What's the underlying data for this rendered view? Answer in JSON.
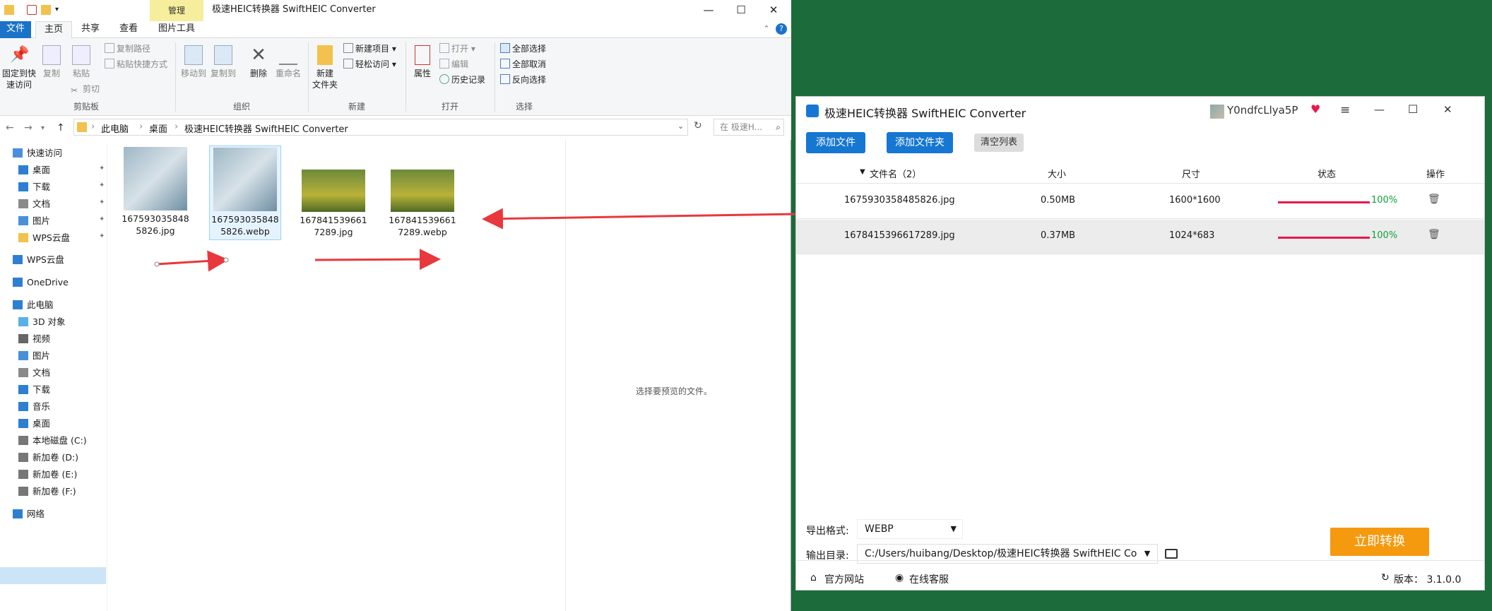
{
  "explorer": {
    "window_title": "极速HEIC转换器 SwiftHEIC Converter",
    "manage_tab": "管理",
    "tabs": [
      "文件",
      "主页",
      "共享",
      "查看",
      "图片工具"
    ],
    "ribbon": {
      "clipboard": {
        "pin": "固定到快速访问",
        "copy": "复制",
        "paste": "粘贴",
        "copy_path": "复制路径",
        "paste_shortcut": "粘贴快捷方式",
        "cut": "剪切",
        "label": "剪贴板"
      },
      "organize": {
        "move_to": "移动到",
        "copy_to": "复制到",
        "delete": "删除",
        "rename": "重命名",
        "label": "组织"
      },
      "new": {
        "new_item": "新建项目",
        "easy_access": "轻松访问",
        "new_folder": "新建\n文件夹",
        "label": "新建"
      },
      "open": {
        "properties": "属性",
        "open": "打开",
        "edit": "编辑",
        "history": "历史记录",
        "label": "打开"
      },
      "select": {
        "select_all": "全部选择",
        "select_none": "全部取消",
        "invert": "反向选择",
        "label": "选择"
      }
    },
    "breadcrumb": [
      "此电脑",
      "桌面",
      "极速HEIC转换器 SwiftHEIC Converter"
    ],
    "search_placeholder": "在 极速H...",
    "nav": [
      {
        "label": "快速访问"
      },
      {
        "label": "桌面"
      },
      {
        "label": "下载"
      },
      {
        "label": "文档"
      },
      {
        "label": "图片"
      },
      {
        "label": "WPS云盘"
      },
      {
        "label": "WPS云盘"
      },
      {
        "label": "OneDrive"
      },
      {
        "label": "此电脑"
      },
      {
        "label": "3D 对象"
      },
      {
        "label": "视频"
      },
      {
        "label": "图片"
      },
      {
        "label": "文档"
      },
      {
        "label": "下载"
      },
      {
        "label": "音乐"
      },
      {
        "label": "桌面"
      },
      {
        "label": "本地磁盘 (C:)"
      },
      {
        "label": "新加卷 (D:)"
      },
      {
        "label": "新加卷 (E:)"
      },
      {
        "label": "新加卷 (F:)"
      },
      {
        "label": "网络"
      }
    ],
    "files": [
      {
        "name": "1675930358485826.jpg"
      },
      {
        "name": "1675930358485826.webp"
      },
      {
        "name": "1678415396617289.jpg"
      },
      {
        "name": "1678415396617289.webp"
      }
    ],
    "preview_text": "选择要预览的文件。"
  },
  "converter": {
    "title": "极速HEIC转换器 SwiftHEIC Converter",
    "user": "Y0ndfcLlya5P",
    "buttons": {
      "add_file": "添加文件",
      "add_folder": "添加文件夹",
      "clear": "清空列表"
    },
    "columns": {
      "name": "文件名（2）",
      "size": "大小",
      "dimensions": "尺寸",
      "status": "状态",
      "actions": "操作"
    },
    "rows": [
      {
        "name": "1675930358485826.jpg",
        "size": "0.50MB",
        "dimensions": "1600*1600",
        "progress": "100%"
      },
      {
        "name": "1678415396617289.jpg",
        "size": "0.37MB",
        "dimensions": "1024*683",
        "progress": "100%"
      }
    ],
    "output_format_label": "导出格式:",
    "output_format": "WEBP",
    "output_dir_label": "输出目录:",
    "output_dir": "C:/Users/huibang/Desktop/极速HEIC转换器 SwiftHEIC Con",
    "convert_button": "立即转换",
    "footer": {
      "website": "官方网站",
      "support": "在线客服",
      "version": "版本： 3.1.0.0"
    }
  },
  "colors": {
    "accent": "#1677d2",
    "convert": "#f59a0f",
    "progress": "#e8184d",
    "ok": "#13a03d",
    "desktop": "#1c6b3a"
  }
}
